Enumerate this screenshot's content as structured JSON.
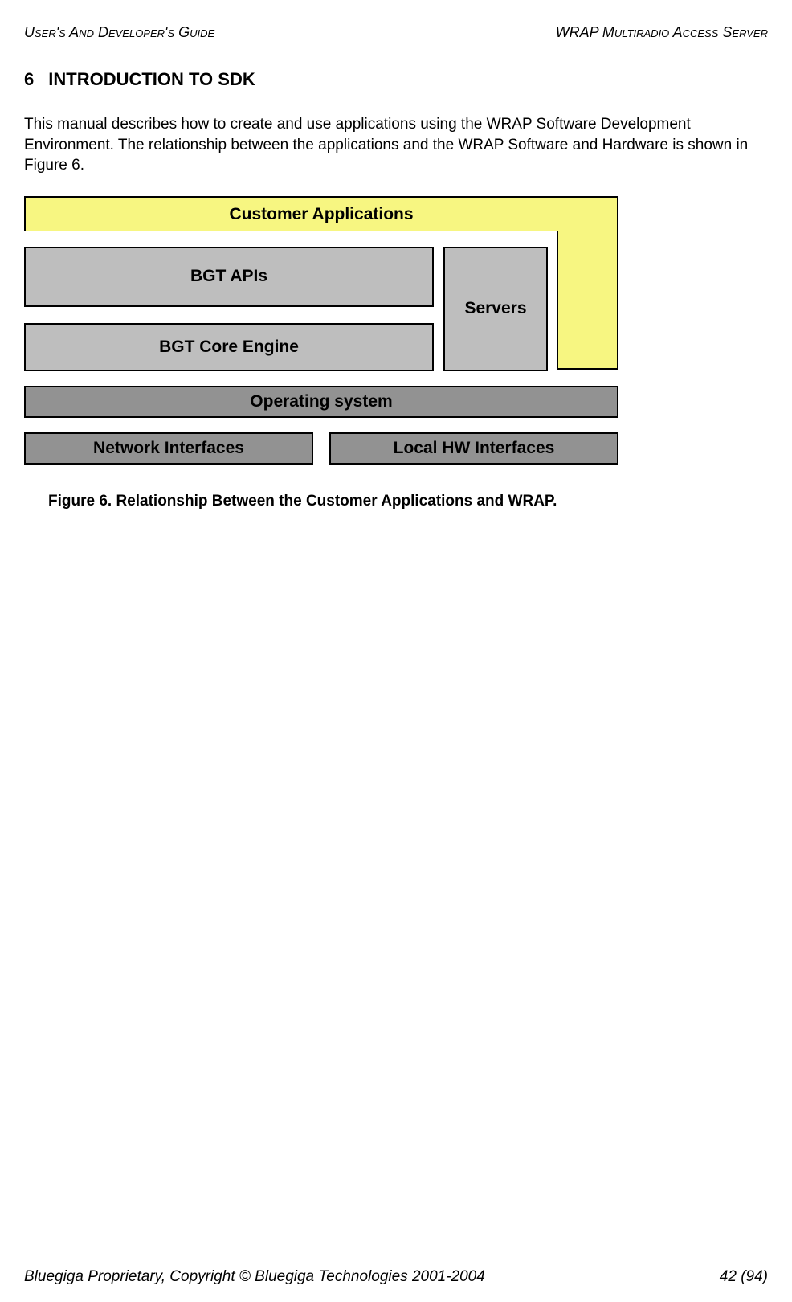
{
  "header": {
    "left": "User's And Developer's Guide",
    "right": "WRAP Multiradio Access Server"
  },
  "section": {
    "number": "6",
    "title": "INTRODUCTION TO SDK"
  },
  "paragraph": "This manual describes how to create and use applications using the WRAP Software Development Environment. The relationship between the applications and the WRAP Software and Hardware is shown in Figure 6.",
  "diagram": {
    "customer_apps": "Customer Applications",
    "bgt_apis": "BGT APIs",
    "bgt_core": "BGT Core Engine",
    "servers": "Servers",
    "os": "Operating system",
    "net_int": "Network Interfaces",
    "local_hw": "Local HW Interfaces"
  },
  "figure_caption": "Figure 6. Relationship Between the Customer Applications and WRAP.",
  "footer": {
    "left": "Bluegiga Proprietary, Copyright © Bluegiga Technologies 2001-2004",
    "right": "42 (94)"
  }
}
